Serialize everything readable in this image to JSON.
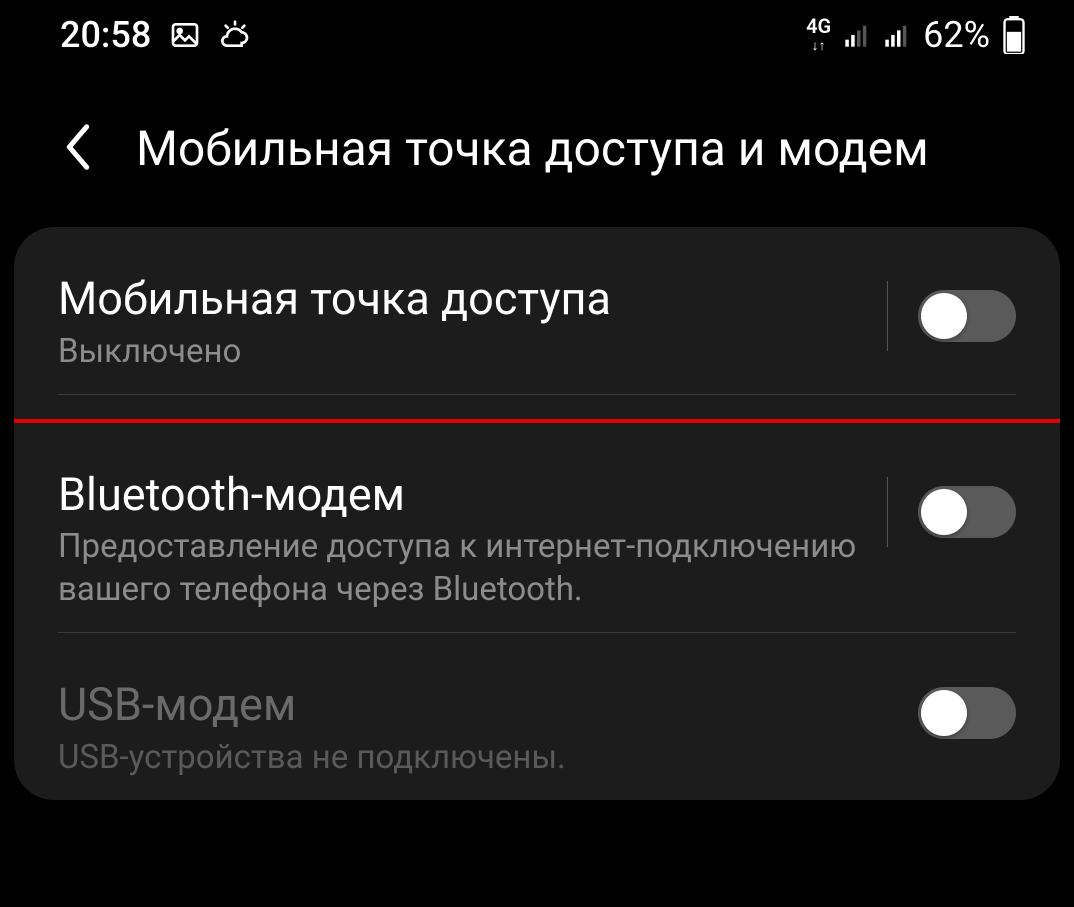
{
  "status_bar": {
    "time": "20:58",
    "network_label": "4G",
    "battery_percent": "62%"
  },
  "header": {
    "title": "Мобильная точка доступа и модем"
  },
  "settings": {
    "hotspot": {
      "title": "Мобильная точка доступа",
      "subtitle": "Выключено"
    },
    "bluetooth": {
      "title": "Bluetooth-модем",
      "subtitle": "Предоставление доступа к интернет-подключению вашего телефона через Bluetooth."
    },
    "usb": {
      "title": "USB-модем",
      "subtitle": "USB-устройства не подключены."
    }
  }
}
